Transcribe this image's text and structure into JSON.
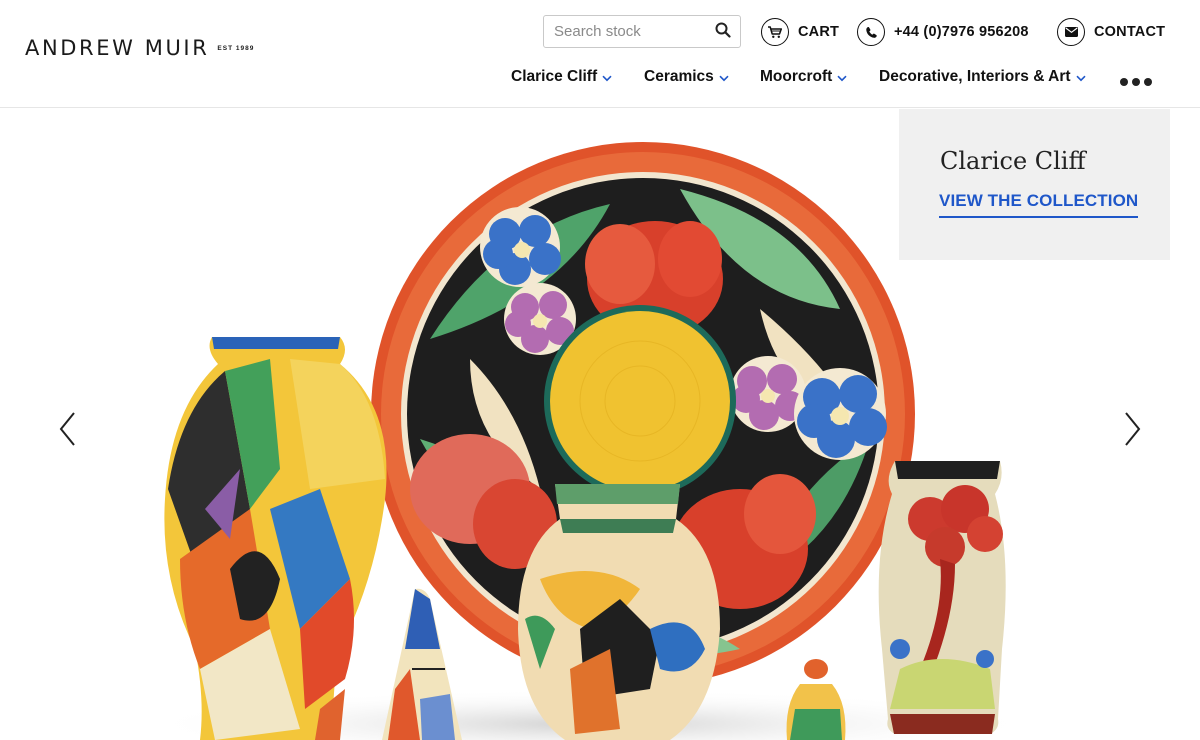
{
  "brand": {
    "name": "ANDREW MUIR",
    "est": "EST 1989"
  },
  "search": {
    "placeholder": "Search stock",
    "icon": "search-icon"
  },
  "utility": {
    "cart_label": "CART",
    "phone_label": "+44 (0)7976 956208",
    "contact_label": "CONTACT"
  },
  "nav": {
    "items": [
      {
        "label": "Clarice Cliff"
      },
      {
        "label": "Ceramics"
      },
      {
        "label": "Moorcroft"
      },
      {
        "label": "Decorative, Interiors & Art"
      }
    ],
    "more_icon": "more-dots-icon"
  },
  "hero": {
    "caption_title": "Clarice Cliff",
    "caption_link": "VIEW THE COLLECTION",
    "prev_icon": "chevron-left-icon",
    "next_icon": "chevron-right-icon"
  },
  "colors": {
    "accent": "#1f57c9",
    "text": "#111111",
    "caption_bg": "#f0f0f0"
  }
}
